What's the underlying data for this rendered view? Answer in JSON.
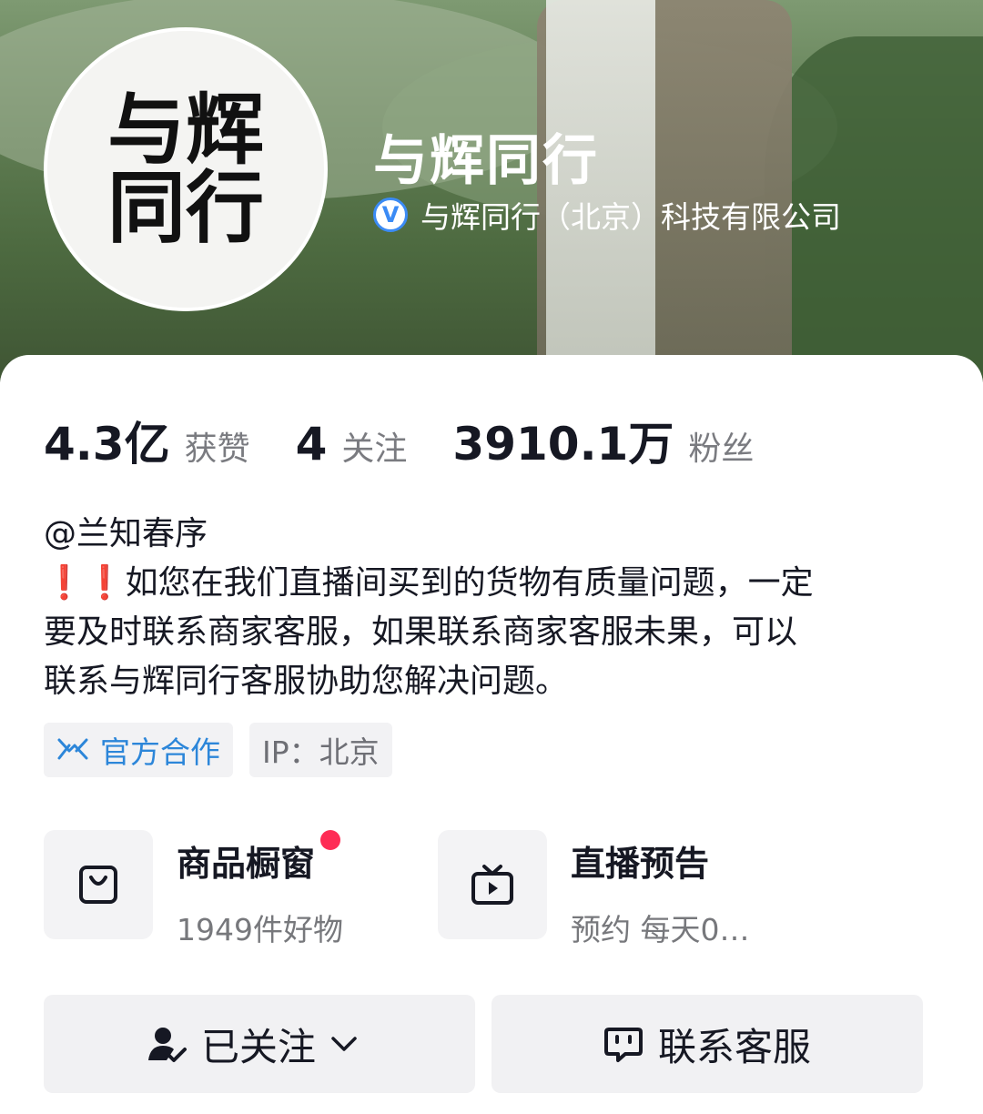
{
  "profile": {
    "name": "与辉同行",
    "verified_text": "与辉同行（北京）科技有限公司",
    "avatar_text": "与辉同行"
  },
  "stats": [
    {
      "value": "4.3亿",
      "label": "获赞"
    },
    {
      "value": "4",
      "label": "关注"
    },
    {
      "value": "3910.1万",
      "label": "粉丝"
    }
  ],
  "bio": {
    "line1": "@兰知春序",
    "line2": "❗❗如您在我们直播间买到的货物有质量问题，一定",
    "line3": "要及时联系商家客服，如果联系商家客服未果，可以",
    "line4": "联系与辉同行客服协助您解决问题。"
  },
  "tags": {
    "official": "官方合作",
    "ip": "IP：北京"
  },
  "shop": {
    "window_title": "商品橱窗",
    "window_sub": "1949件好物",
    "live_title": "直播预告",
    "live_sub": "预约 每天0…"
  },
  "buttons": {
    "following": "已关注",
    "contact": "联系客服"
  },
  "colors": {
    "accent_red": "#fe2c55",
    "official_blue": "#2c86d9",
    "verified_blue": "#3b8bf5"
  }
}
